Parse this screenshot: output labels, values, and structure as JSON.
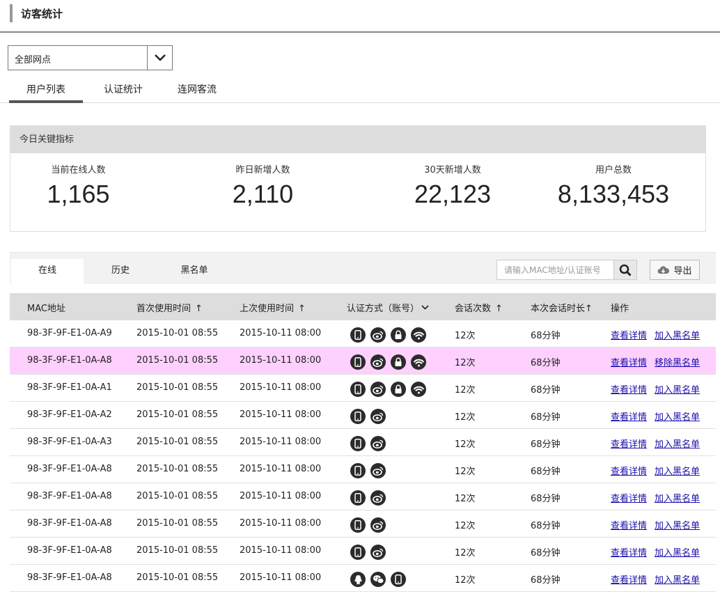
{
  "page": {
    "title": "访客统计"
  },
  "site_select": {
    "value": "全部网点"
  },
  "main_tabs": [
    "用户列表",
    "认证统计",
    "连网客流"
  ],
  "kpi": {
    "heading": "今日关键指标",
    "items": [
      {
        "label": "当前在线人数",
        "value": "1,165"
      },
      {
        "label": "昨日新增人数",
        "value": "2,110"
      },
      {
        "label": "30天新增人数",
        "value": "22,123"
      },
      {
        "label": "用户总数",
        "value": "8,133,453"
      }
    ]
  },
  "sub_tabs": [
    "在线",
    "历史",
    "黑名单"
  ],
  "search": {
    "placeholder": "请输入MAC地址/认证账号"
  },
  "export": {
    "label": "导出"
  },
  "table": {
    "columns": [
      "MAC地址",
      "首次使用时间",
      "上次使用时间",
      "认证方式（账号）",
      "会话次数",
      "本次会话时长",
      "操作"
    ],
    "sort_arrows": {
      "first": "↑",
      "last": "↑",
      "count": "↑",
      "duration": "↑"
    },
    "rows": [
      {
        "mac": "98-3F-9F-E1-0A-A9",
        "first": "2015-10-01 08:55",
        "last": "2015-10-11 08:00",
        "auth": [
          "phone-icon",
          "weibo-icon",
          "lock-icon",
          "wifi-icon"
        ],
        "count": "12次",
        "duration": "68分钟",
        "detail": "查看详情",
        "action": "加入黑名单",
        "highlight": false
      },
      {
        "mac": "98-3F-9F-E1-0A-A8",
        "first": "2015-10-01 08:55",
        "last": "2015-10-11 08:00",
        "auth": [
          "phone-icon",
          "weibo-icon",
          "lock-icon",
          "wifi-icon"
        ],
        "count": "12次",
        "duration": "68分钟",
        "detail": "查看详情",
        "action": "移除黑名单",
        "highlight": true
      },
      {
        "mac": "98-3F-9F-E1-0A-A1",
        "first": "2015-10-01 08:55",
        "last": "2015-10-11 08:00",
        "auth": [
          "phone-icon",
          "weibo-icon",
          "lock-icon",
          "wifi-icon"
        ],
        "count": "12次",
        "duration": "68分钟",
        "detail": "查看详情",
        "action": "加入黑名单",
        "highlight": false
      },
      {
        "mac": "98-3F-9F-E1-0A-A2",
        "first": "2015-10-01 08:55",
        "last": "2015-10-11 08:00",
        "auth": [
          "phone-icon",
          "weibo-icon"
        ],
        "count": "12次",
        "duration": "68分钟",
        "detail": "查看详情",
        "action": "加入黑名单",
        "highlight": false
      },
      {
        "mac": "98-3F-9F-E1-0A-A3",
        "first": "2015-10-01 08:55",
        "last": "2015-10-11 08:00",
        "auth": [
          "phone-icon",
          "weibo-icon"
        ],
        "count": "12次",
        "duration": "68分钟",
        "detail": "查看详情",
        "action": "加入黑名单",
        "highlight": false
      },
      {
        "mac": "98-3F-9F-E1-0A-A8",
        "first": "2015-10-01 08:55",
        "last": "2015-10-11 08:00",
        "auth": [
          "phone-icon",
          "weibo-icon"
        ],
        "count": "12次",
        "duration": "68分钟",
        "detail": "查看详情",
        "action": "加入黑名单",
        "highlight": false
      },
      {
        "mac": "98-3F-9F-E1-0A-A8",
        "first": "2015-10-01 08:55",
        "last": "2015-10-11 08:00",
        "auth": [
          "phone-icon",
          "weibo-icon"
        ],
        "count": "12次",
        "duration": "68分钟",
        "detail": "查看详情",
        "action": "加入黑名单",
        "highlight": false
      },
      {
        "mac": "98-3F-9F-E1-0A-A8",
        "first": "2015-10-01 08:55",
        "last": "2015-10-11 08:00",
        "auth": [
          "phone-icon",
          "weibo-icon"
        ],
        "count": "12次",
        "duration": "68分钟",
        "detail": "查看详情",
        "action": "加入黑名单",
        "highlight": false
      },
      {
        "mac": "98-3F-9F-E1-0A-A8",
        "first": "2015-10-01 08:55",
        "last": "2015-10-11 08:00",
        "auth": [
          "phone-icon",
          "weibo-icon"
        ],
        "count": "12次",
        "duration": "68分钟",
        "detail": "查看详情",
        "action": "加入黑名单",
        "highlight": false
      },
      {
        "mac": "98-3F-9F-E1-0A-A8",
        "first": "2015-10-01 08:55",
        "last": "2015-10-11 08:00",
        "auth": [
          "qq-icon",
          "wechat-icon",
          "phone-icon"
        ],
        "count": "12次",
        "duration": "68分钟",
        "detail": "查看详情",
        "action": "加入黑名单",
        "highlight": false
      }
    ]
  }
}
